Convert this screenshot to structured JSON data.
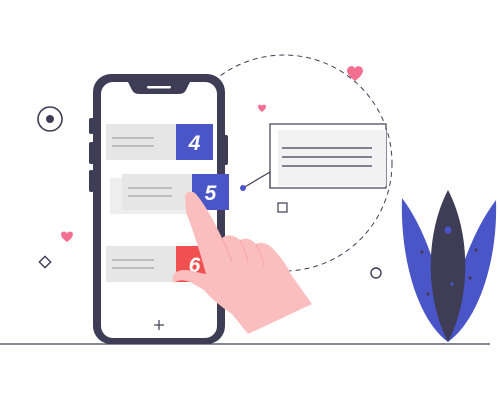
{
  "phone": {
    "cards": [
      {
        "number": "4",
        "badge_color": "#4a55c7"
      },
      {
        "number": "5",
        "badge_color": "#4a55c7"
      },
      {
        "number": "6",
        "badge_color": "#f05050"
      }
    ],
    "home_icon": "plus-icon"
  },
  "colors": {
    "phone_frame": "#3f3d56",
    "accent_blue": "#4a55c7",
    "accent_red": "#f05050",
    "heart": "#f47090",
    "skin": "#fbbebe",
    "card_bg": "#e6e6e6"
  },
  "icons": [
    "heart-icon",
    "target-icon",
    "diamond-icon",
    "square-icon",
    "circle-icon",
    "plus-icon"
  ]
}
